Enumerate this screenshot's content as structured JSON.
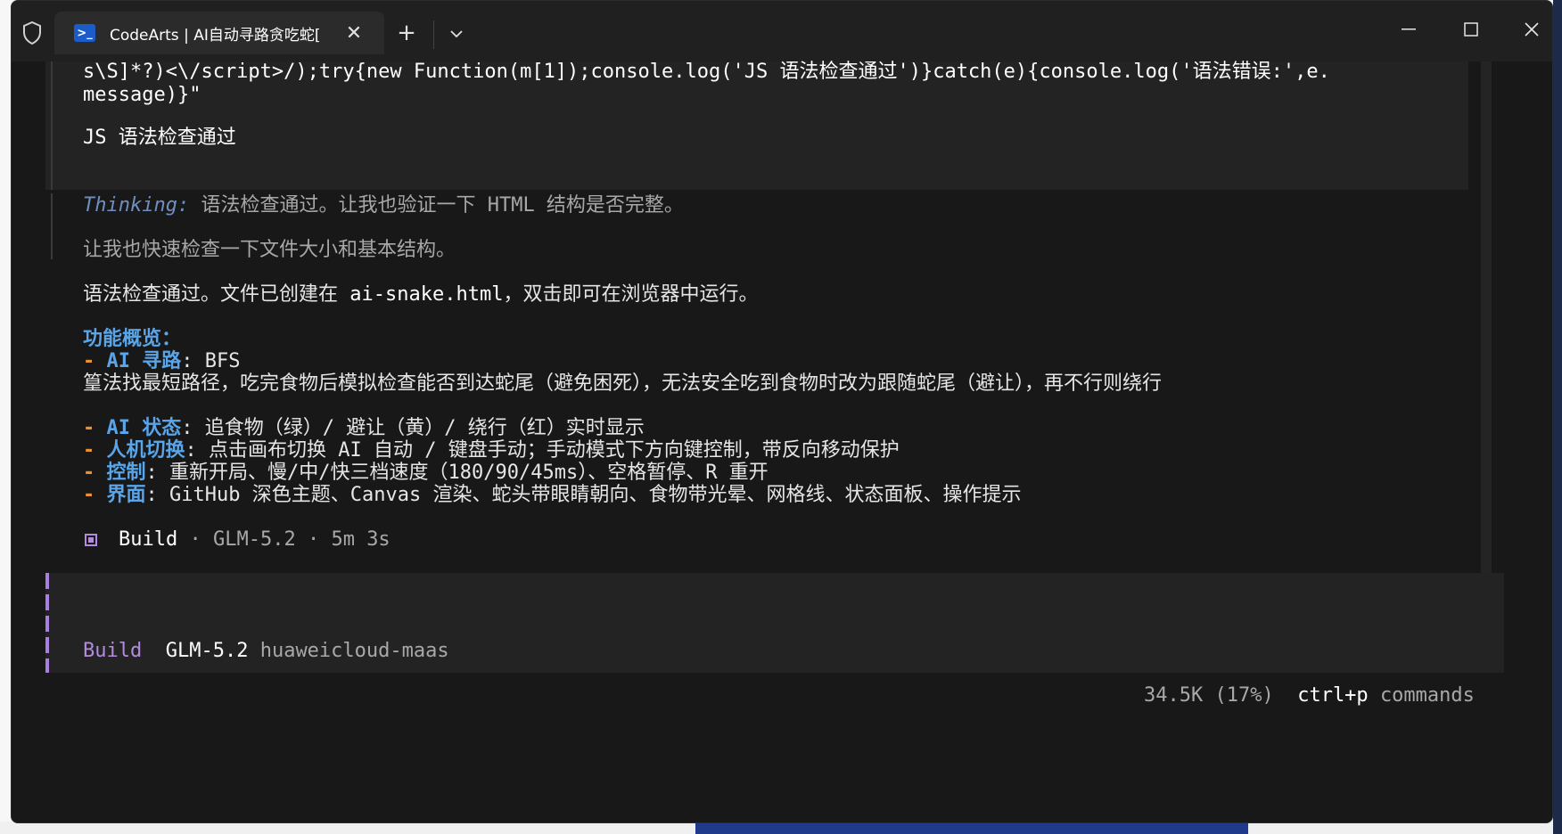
{
  "window": {
    "tab_title": "CodeArts | AI自动寻路贪吃蛇[",
    "tab_close": "✕",
    "new_tab": "+",
    "dropdown": "⌄",
    "minimize": "—",
    "maximize": "☐",
    "close": "✕"
  },
  "code": {
    "line1": "s\\S]*?)<\\/script>/);try{new Function(m[1]);console.log('JS 语法检查通过')}catch(e){console.log('语法错误:',e.",
    "line2": "message)}\"",
    "output": "JS 语法检查通过"
  },
  "thinking": {
    "label": "Thinking:",
    "text": " 语法检查通过。让我也验证一下 HTML 结构是否完整。",
    "text2": "让我也快速检查一下文件大小和基本结构。"
  },
  "summary": {
    "created_prefix": "语法检查通过。文件已创建在 ",
    "filename": "ai-snake.html",
    "created_suffix": "，双击即可在浏览器中运行。",
    "heading": "功能概览：",
    "items": [
      {
        "dash": "- ",
        "label": "AI 寻路",
        "text": ": BFS"
      },
      {
        "dash": "",
        "label": "",
        "text": "篁法找最短路径，吃完食物后模拟检查能否到达蛇尾（避免困死），无法安全吃到食物时改为跟随蛇尾（避让），再不行则绕行"
      },
      {
        "dash": "- ",
        "label": "AI 状态",
        "text": ": 追食物（绿）/ 避让（黄）/ 绕行（红）实时显示"
      },
      {
        "dash": "- ",
        "label": "人机切换",
        "text": ": 点击画布切换 AI 自动 / 键盘手动；手动模式下方向键控制，带反向移动保护"
      },
      {
        "dash": "- ",
        "label": "控制",
        "text": ": 重新开局、慢/中/快三档速度（180/90/45ms）、空格暂停、R 重开"
      },
      {
        "dash": "- ",
        "label": "界面",
        "text": ": GitHub 深色主题、Canvas 渲染、蛇头带眼睛朝向、食物带光晕、网格线、状态面板、操作提示"
      }
    ]
  },
  "status": {
    "mode": "Build",
    "sep": " · ",
    "model": "GLM-5.2",
    "duration": "5m 3s"
  },
  "input": {
    "mode": "Build",
    "model": "GLM-5.2",
    "provider": "huaweicloud-maas"
  },
  "footer": {
    "tokens": "34.5K (17%)",
    "shortcut": "ctrl+p",
    "commands": "commands"
  }
}
